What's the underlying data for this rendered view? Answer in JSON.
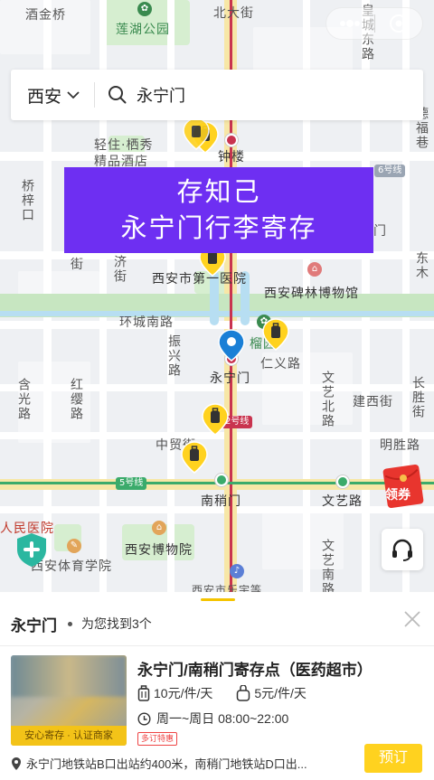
{
  "map": {
    "labels": {
      "jiujinqiao": "酒金桥",
      "lianhu_park": "莲湖公园",
      "beidajie": "北大街",
      "huangcheng_dong_lu": "皇城东路",
      "qinggong_hotel_1": "轻住·栖秀",
      "qinggong_hotel_2": "精品酒店",
      "zhonglou": "钟楼",
      "defu_xiang": "德福巷",
      "qiaozilu": "桥梓口",
      "jie_partial": "街",
      "qingjie": "济街",
      "line6": "6号线",
      "men_partial": "门",
      "dongmu": "东木",
      "hospital": "西安市第一医院",
      "beilin_museum": "西安碑林博物馆",
      "huancheng_south": "环城南路",
      "zhenxing": "振兴路",
      "liuer": "榴园",
      "renyi": "仁义路",
      "yongningmen_station": "永宁门",
      "hanguang": "含光路",
      "honglinglu": "红缨路",
      "wenyi_north": "文艺北路",
      "jianxi": "建西街",
      "changsheng": "长胜街",
      "line2": "2号线",
      "zhongmao": "中贸街",
      "mingsheng": "明胜路",
      "line5": "5号线",
      "nanshaomen": "南稍门",
      "wenyilu": "文艺路",
      "people_hospital": "人民医院",
      "xian_museum": "西安博物院",
      "sports_school": "西安体育学院",
      "wenyi_south": "文艺南路",
      "bottom_partial": "西安市乐宇等"
    },
    "coupon_label": "领券"
  },
  "search": {
    "city": "西安",
    "query": "永宁门"
  },
  "banner": {
    "line1": "存知己",
    "line2": "永宁门行李寄存"
  },
  "panel": {
    "query": "永宁门",
    "found_text": "为您找到3个",
    "item": {
      "title": "永宁门/南稍门寄存点（医药超市）",
      "price_large": "10元/件/天",
      "price_small": "5元/件/天",
      "hours": "周一~周日 08:00~22:00",
      "tag": "多订特惠",
      "ribbon": "安心寄存 · 认证商家",
      "address": "永宁门地铁站B口出站约400米，南稍门地铁站D口出...",
      "book_label": "预订"
    }
  },
  "colors": {
    "accent_yellow": "#ffd21f",
    "banner_purple": "#6e2ff2",
    "metro_red": "#c9344f",
    "metro_green": "#3bab6b",
    "pin_blue": "#1a7fd6"
  }
}
